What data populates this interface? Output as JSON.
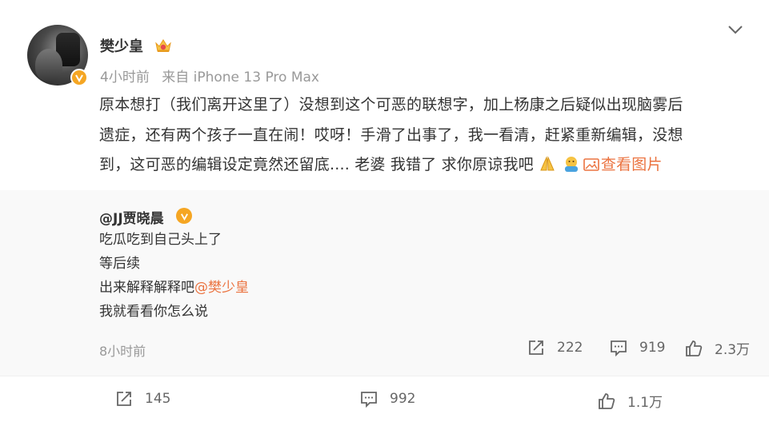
{
  "post": {
    "author": "樊少皇",
    "time": "4小时前",
    "source": "来自 iPhone 13 Pro Max",
    "text_lines": [
      "原本想打（我们离开这里了）没想到这个可恶的联想字，加上杨康之后疑似出现脑雾后",
      "遗症，还有两个孩子一直在闹！哎呀！手滑了出事了，我一看清，赶紧重新编辑，没想",
      "到，这可恶的编辑设定竟然还留底.... 老婆 我错了 求你原谅我吧"
    ],
    "view_pics_label": "查看图片",
    "stats": {
      "reposts": "145",
      "comments": "992",
      "likes": "1.1万"
    }
  },
  "repost": {
    "author": "@JJ贾晓晨",
    "lines": [
      "吃瓜吃到自己头上了",
      "等后续",
      "出来解释解释吧"
    ],
    "mention": "@樊少皇",
    "last_line": "我就看看你怎么说",
    "time": "8小时前",
    "stats": {
      "reposts": "222",
      "comments": "919",
      "likes": "2.3万"
    }
  },
  "icons": {
    "verified": "verified-badge-icon",
    "crown": "crown-icon",
    "menu": "chevron-down-icon",
    "share": "share-icon",
    "comment": "comment-icon",
    "like": "thumbs-up-icon",
    "picture": "picture-icon",
    "emoji_pray": "pray-emoji-icon",
    "emoji_hug": "hug-emoji-icon"
  },
  "colors": {
    "accent": "#eb7340",
    "verified": "#f5a623",
    "muted": "#999999"
  }
}
